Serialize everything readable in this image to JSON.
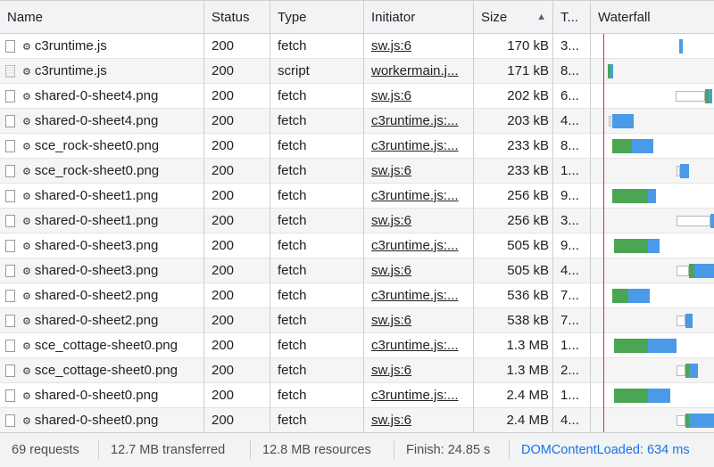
{
  "header": {
    "name": "Name",
    "status": "Status",
    "type": "Type",
    "initiator": "Initiator",
    "size": "Size",
    "sort_indicator": "▲",
    "time": "T...",
    "waterfall": "Waterfall"
  },
  "rows": [
    {
      "name": "c3runtime.js",
      "status": "200",
      "type": "fetch",
      "initiator": "sw.js:6",
      "size": "170 kB",
      "time": "3...",
      "icon": "file-icon"
    },
    {
      "name": "c3runtime.js",
      "status": "200",
      "type": "script",
      "initiator": "workermain.j...",
      "size": "171 kB",
      "time": "8...",
      "icon": "script-file-icon"
    },
    {
      "name": "shared-0-sheet4.png",
      "status": "200",
      "type": "fetch",
      "initiator": "sw.js:6",
      "size": "202 kB",
      "time": "6...",
      "icon": "file-icon"
    },
    {
      "name": "shared-0-sheet4.png",
      "status": "200",
      "type": "fetch",
      "initiator": "c3runtime.js:...",
      "size": "203 kB",
      "time": "4...",
      "icon": "file-icon"
    },
    {
      "name": "sce_rock-sheet0.png",
      "status": "200",
      "type": "fetch",
      "initiator": "c3runtime.js:...",
      "size": "233 kB",
      "time": "8...",
      "icon": "file-icon"
    },
    {
      "name": "sce_rock-sheet0.png",
      "status": "200",
      "type": "fetch",
      "initiator": "sw.js:6",
      "size": "233 kB",
      "time": "1...",
      "icon": "file-icon"
    },
    {
      "name": "shared-0-sheet1.png",
      "status": "200",
      "type": "fetch",
      "initiator": "c3runtime.js:...",
      "size": "256 kB",
      "time": "9...",
      "icon": "file-icon"
    },
    {
      "name": "shared-0-sheet1.png",
      "status": "200",
      "type": "fetch",
      "initiator": "sw.js:6",
      "size": "256 kB",
      "time": "3...",
      "icon": "file-icon"
    },
    {
      "name": "shared-0-sheet3.png",
      "status": "200",
      "type": "fetch",
      "initiator": "c3runtime.js:...",
      "size": "505 kB",
      "time": "9...",
      "icon": "file-icon"
    },
    {
      "name": "shared-0-sheet3.png",
      "status": "200",
      "type": "fetch",
      "initiator": "sw.js:6",
      "size": "505 kB",
      "time": "4...",
      "icon": "file-icon"
    },
    {
      "name": "shared-0-sheet2.png",
      "status": "200",
      "type": "fetch",
      "initiator": "c3runtime.js:...",
      "size": "536 kB",
      "time": "7...",
      "icon": "file-icon"
    },
    {
      "name": "shared-0-sheet2.png",
      "status": "200",
      "type": "fetch",
      "initiator": "sw.js:6",
      "size": "538 kB",
      "time": "7...",
      "icon": "file-icon"
    },
    {
      "name": "sce_cottage-sheet0.png",
      "status": "200",
      "type": "fetch",
      "initiator": "c3runtime.js:...",
      "size": "1.3 MB",
      "time": "1...",
      "icon": "file-icon"
    },
    {
      "name": "sce_cottage-sheet0.png",
      "status": "200",
      "type": "fetch",
      "initiator": "sw.js:6",
      "size": "1.3 MB",
      "time": "2...",
      "icon": "file-icon"
    },
    {
      "name": "shared-0-sheet0.png",
      "status": "200",
      "type": "fetch",
      "initiator": "c3runtime.js:...",
      "size": "2.4 MB",
      "time": "1...",
      "icon": "file-icon"
    },
    {
      "name": "shared-0-sheet0.png",
      "status": "200",
      "type": "fetch",
      "initiator": "sw.js:6",
      "size": "2.4 MB",
      "time": "4...",
      "icon": "file-icon"
    }
  ],
  "footer": {
    "requests": "69 requests",
    "transferred": "12.7 MB transferred",
    "resources": "12.8 MB resources",
    "finish": "Finish: 24.85 s",
    "dcl": "DOMContentLoaded: 634 ms"
  },
  "colors": {
    "download": "#4a9ae8",
    "waiting": "#4aa652",
    "dcl_line": "#c0392b",
    "dcl_text": "#1a73e8"
  }
}
